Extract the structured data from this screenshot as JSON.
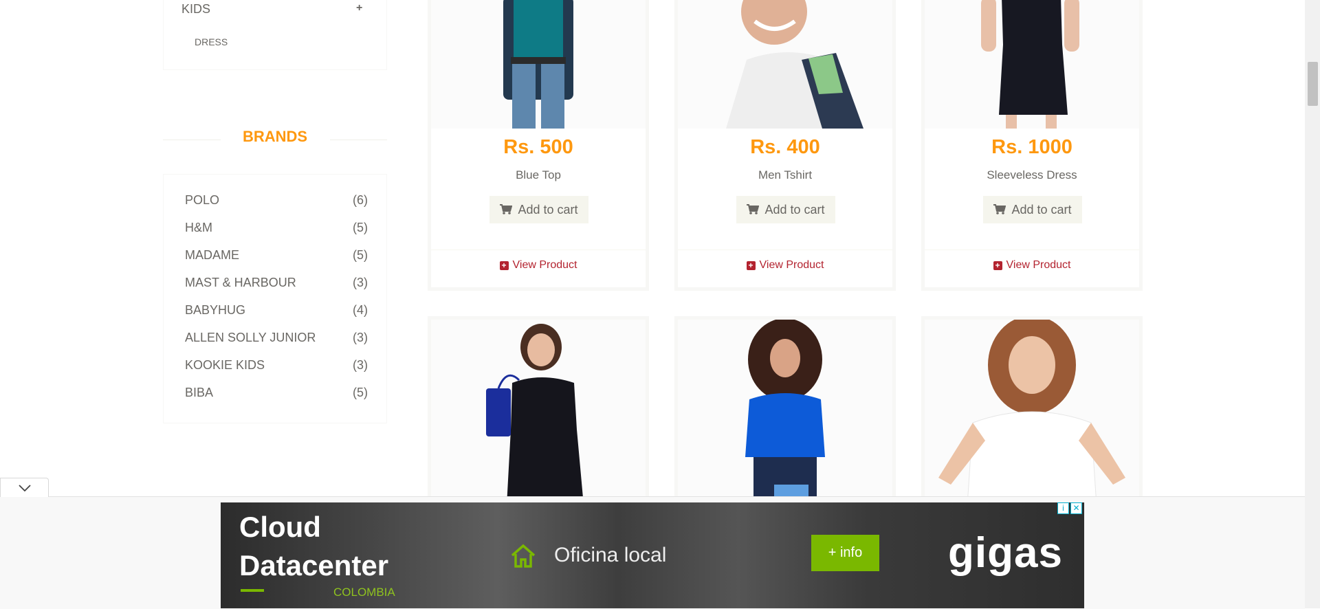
{
  "sidebar": {
    "category": {
      "title": "KIDS",
      "toggle": "+",
      "subitem": "DRESS"
    },
    "brands": {
      "title": "BRANDS",
      "items": [
        {
          "name": "POLO",
          "count": "(6)"
        },
        {
          "name": "H&M",
          "count": "(5)"
        },
        {
          "name": "MADAME",
          "count": "(5)"
        },
        {
          "name": "MAST & HARBOUR",
          "count": "(3)"
        },
        {
          "name": "BABYHUG",
          "count": "(4)"
        },
        {
          "name": "ALLEN SOLLY JUNIOR",
          "count": "(3)"
        },
        {
          "name": "KOOKIE KIDS",
          "count": "(3)"
        },
        {
          "name": "BIBA",
          "count": "(5)"
        }
      ]
    }
  },
  "products": [
    {
      "price": "Rs. 500",
      "name": "Blue Top",
      "cart_label": "Add to cart",
      "view_label": "View Product"
    },
    {
      "price": "Rs. 400",
      "name": "Men Tshirt",
      "cart_label": "Add to cart",
      "view_label": "View Product"
    },
    {
      "price": "Rs. 1000",
      "name": "Sleeveless Dress",
      "cart_label": "Add to cart",
      "view_label": "View Product"
    }
  ],
  "ad": {
    "headline_line1": "Cloud",
    "headline_line2": "Datacenter",
    "country": "COLOMBIA",
    "office": "Oficina local",
    "info_button": "+ info",
    "logo": "gigas",
    "badge_info": "i",
    "badge_close": "✕"
  },
  "colors": {
    "accent": "#FE980F",
    "link": "#B3232F",
    "ad_green": "#7ab800"
  }
}
